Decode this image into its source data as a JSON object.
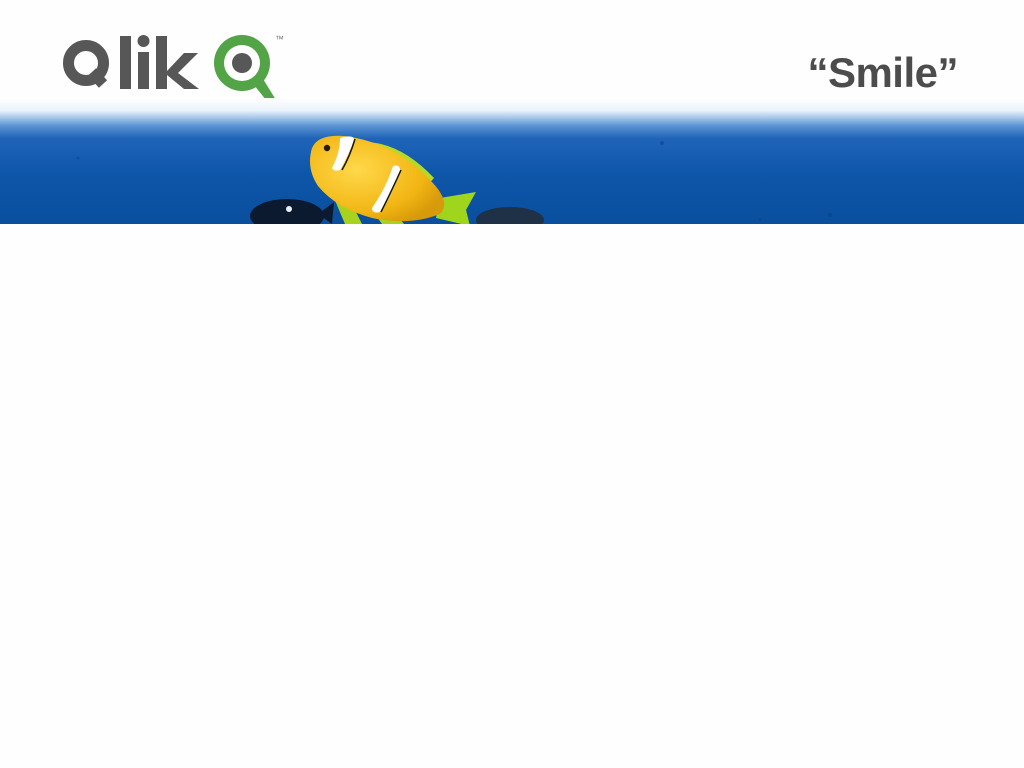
{
  "slide": {
    "title": "“Smile”",
    "title_color": "#4c4c4c"
  },
  "logo": {
    "text": "Qlik",
    "trademark": "™",
    "wordmark_color": "#575757",
    "mark_color": "#52a447"
  },
  "banner": {
    "subject": "ocean-clownfish-photo",
    "water_color": "#0d55a8",
    "fish_color": "#f5c21a"
  }
}
